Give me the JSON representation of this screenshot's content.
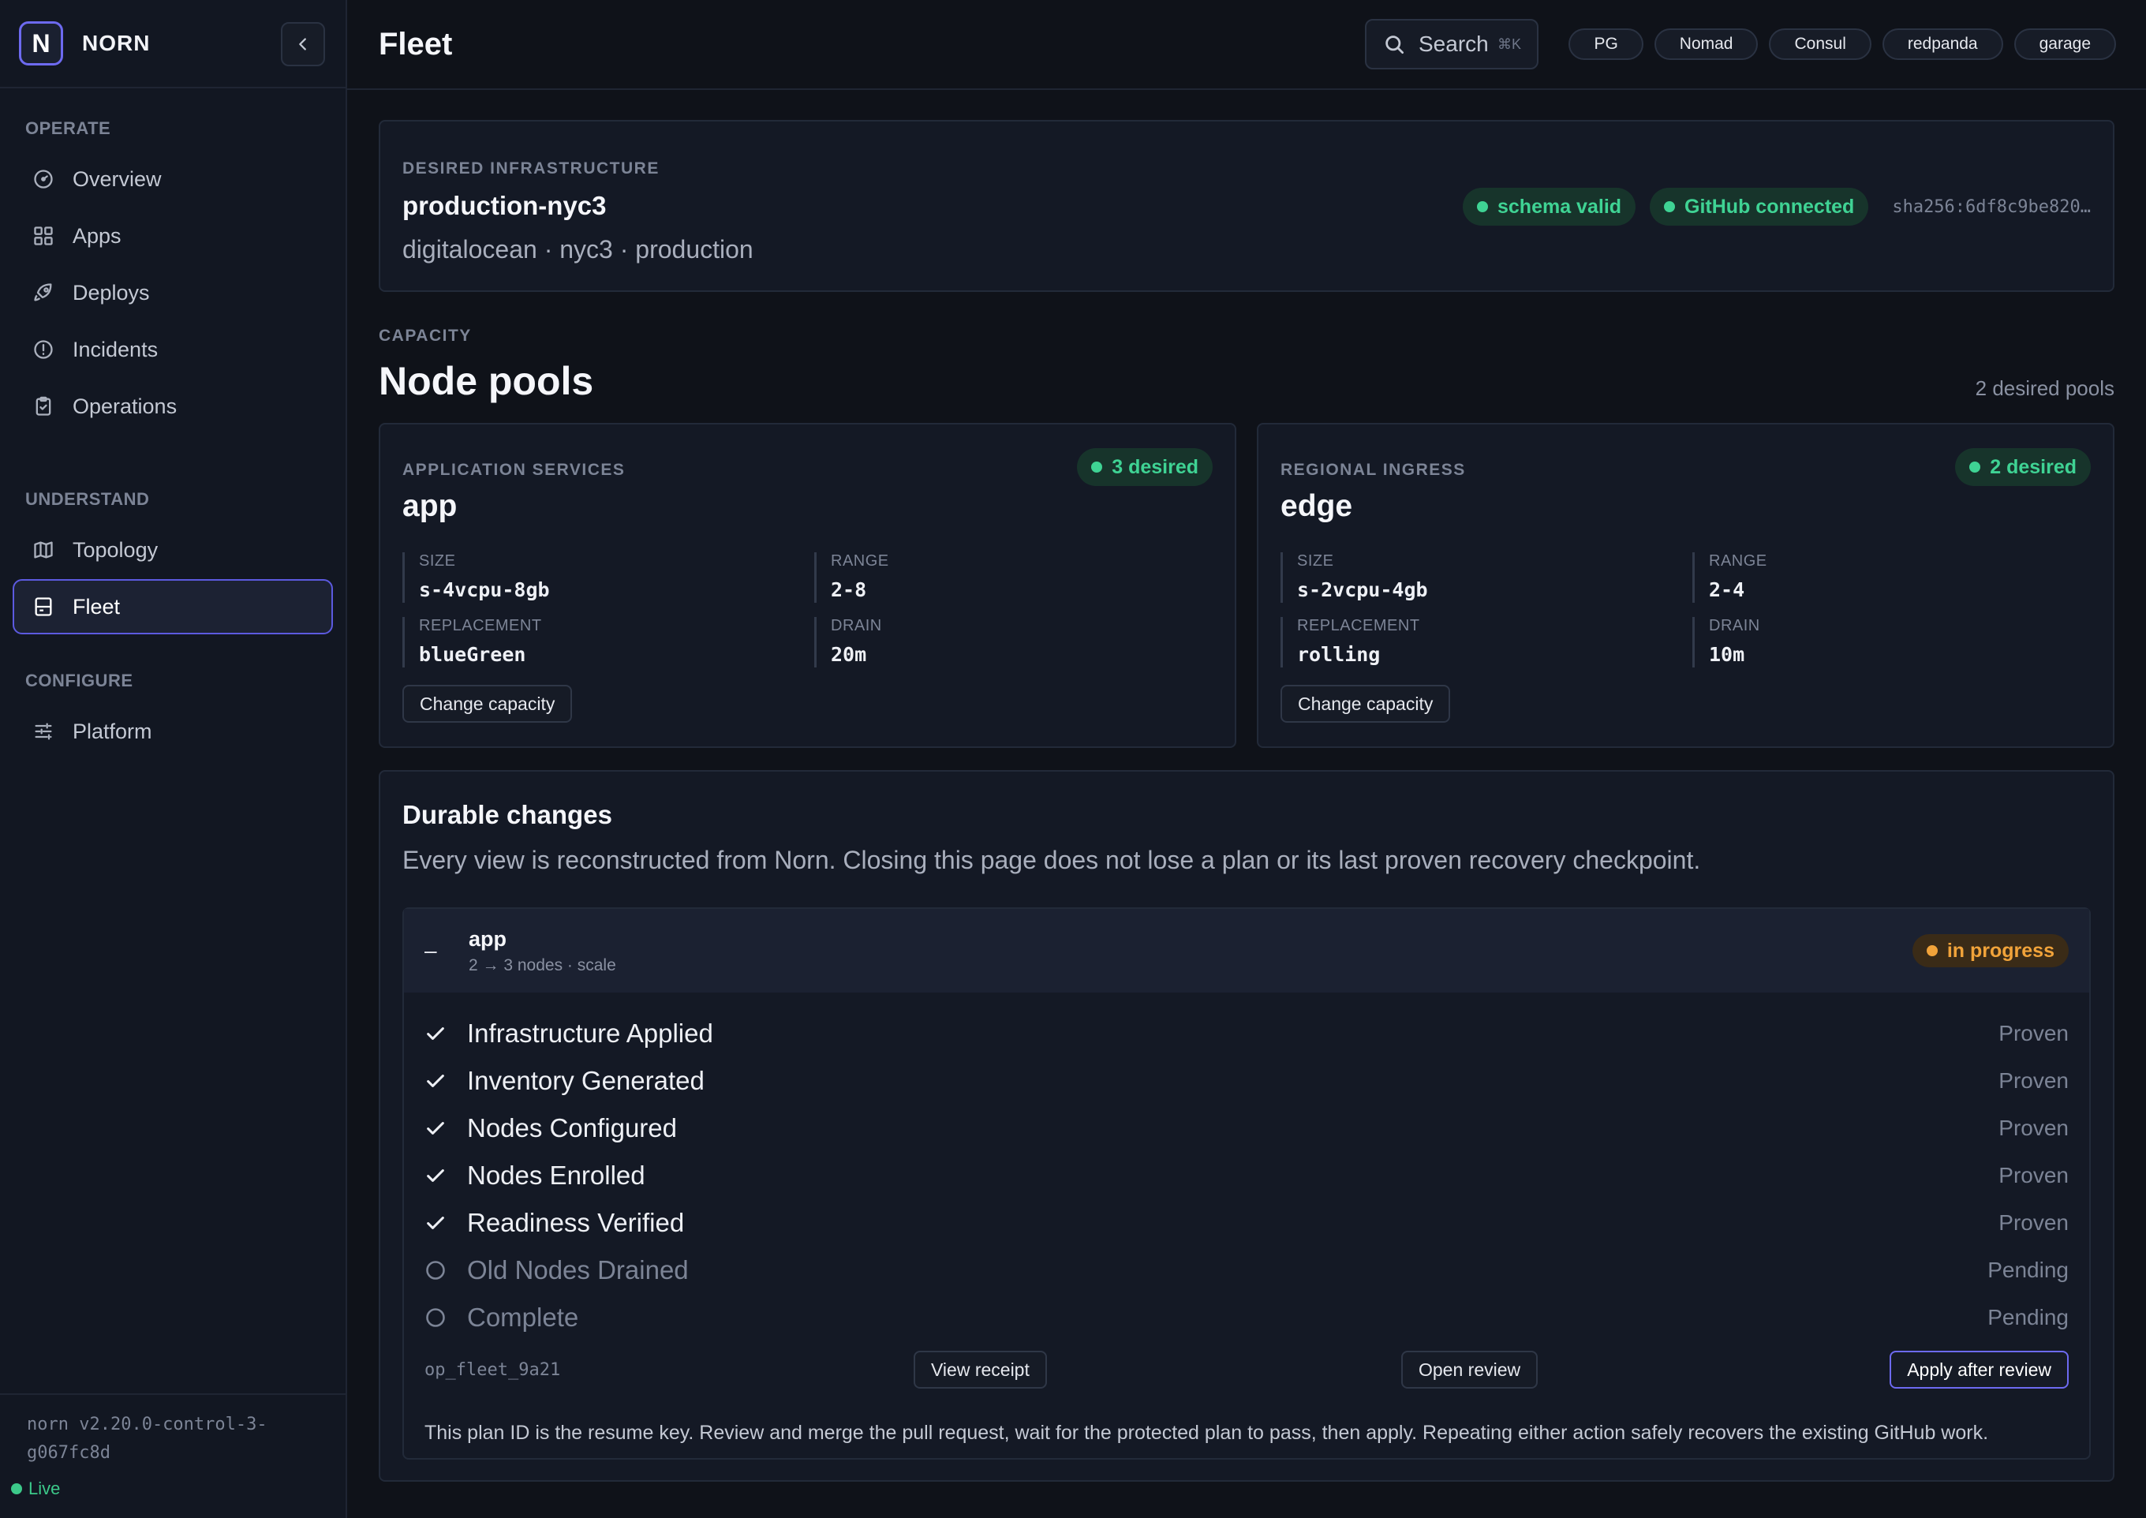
{
  "brand": {
    "logo_letter": "N",
    "name": "NORN"
  },
  "sidebar": {
    "sections": [
      {
        "heading": "OPERATE",
        "items": [
          {
            "label": "Overview",
            "icon": "gauge-icon"
          },
          {
            "label": "Apps",
            "icon": "grid-icon"
          },
          {
            "label": "Deploys",
            "icon": "rocket-icon"
          },
          {
            "label": "Incidents",
            "icon": "alert-circle-icon"
          },
          {
            "label": "Operations",
            "icon": "clipboard-icon"
          }
        ]
      },
      {
        "heading": "UNDERSTAND",
        "items": [
          {
            "label": "Topology",
            "icon": "map-icon"
          },
          {
            "label": "Fleet",
            "icon": "server-icon",
            "active": true
          }
        ]
      },
      {
        "heading": "CONFIGURE",
        "items": [
          {
            "label": "Platform",
            "icon": "sliders-icon"
          }
        ]
      }
    ],
    "version_line1": "norn v2.20.0-control-3-",
    "version_line2": "g067fc8d",
    "live_label": "Live"
  },
  "header": {
    "title": "Fleet",
    "search_label": "Search",
    "search_shortcut": "⌘K",
    "service_chips": [
      "PG",
      "Nomad",
      "Consul",
      "redpanda",
      "garage"
    ]
  },
  "infrastructure": {
    "eyebrow": "DESIRED INFRASTRUCTURE",
    "name": "production-nyc3",
    "subtitle": "digitalocean · nyc3 · production",
    "badges": [
      "schema valid",
      "GitHub connected"
    ],
    "sha": "sha256:6df8c9be820…"
  },
  "capacity": {
    "eyebrow": "CAPACITY",
    "title": "Node pools",
    "count": "2 desired pools",
    "pools": [
      {
        "eyebrow": "APPLICATION SERVICES",
        "name": "app",
        "badge": "3 desired",
        "specs": [
          {
            "label": "SIZE",
            "value": "s-4vcpu-8gb"
          },
          {
            "label": "RANGE",
            "value": "2-8"
          },
          {
            "label": "REPLACEMENT",
            "value": "blueGreen"
          },
          {
            "label": "DRAIN",
            "value": "20m"
          }
        ],
        "button": "Change capacity"
      },
      {
        "eyebrow": "REGIONAL INGRESS",
        "name": "edge",
        "badge": "2 desired",
        "specs": [
          {
            "label": "SIZE",
            "value": "s-2vcpu-4gb"
          },
          {
            "label": "RANGE",
            "value": "2-4"
          },
          {
            "label": "REPLACEMENT",
            "value": "rolling"
          },
          {
            "label": "DRAIN",
            "value": "10m"
          }
        ],
        "button": "Change capacity"
      }
    ]
  },
  "durable": {
    "title": "Durable changes",
    "description": "Every view is reconstructed from Norn. Closing this page does not lose a plan or its last proven recovery checkpoint.",
    "plan": {
      "toggle": "–",
      "name": "app",
      "meta": "2 → 3 nodes · scale",
      "status": "in progress",
      "steps": [
        {
          "label": "Infrastructure Applied",
          "status": "Proven",
          "done": true
        },
        {
          "label": "Inventory Generated",
          "status": "Proven",
          "done": true
        },
        {
          "label": "Nodes Configured",
          "status": "Proven",
          "done": true
        },
        {
          "label": "Nodes Enrolled",
          "status": "Proven",
          "done": true
        },
        {
          "label": "Readiness Verified",
          "status": "Proven",
          "done": true
        },
        {
          "label": "Old Nodes Drained",
          "status": "Pending",
          "done": false
        },
        {
          "label": "Complete",
          "status": "Pending",
          "done": false
        }
      ],
      "op_id": "op_fleet_9a21",
      "view_receipt": "View receipt",
      "open_review": "Open review",
      "apply": "Apply after review",
      "note": "This plan ID is the resume key. Review and merge the pull request, wait for the protected plan to pass, then apply. Repeating either action safely recovers the existing GitHub work."
    }
  },
  "colors": {
    "accent": "#6d6af0",
    "success": "#3fd394",
    "warning": "#f1a33a",
    "background": "#0f1219"
  }
}
